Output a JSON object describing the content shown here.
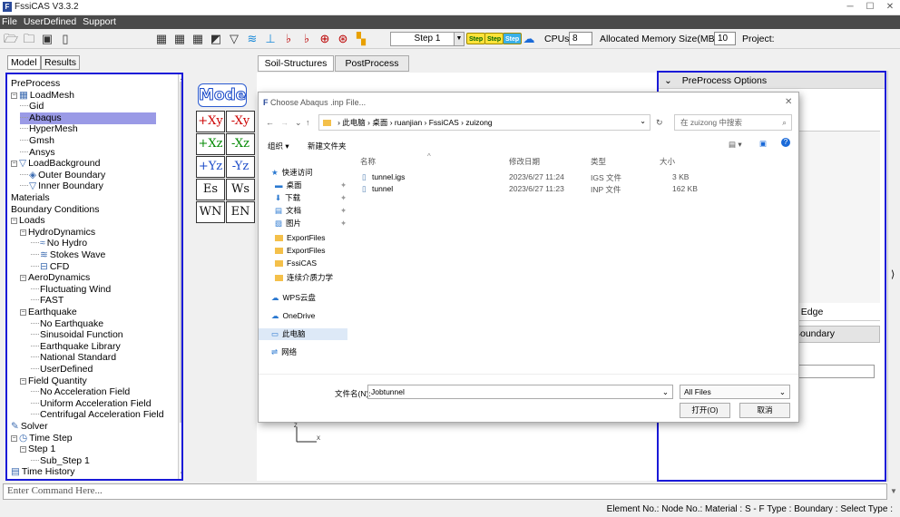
{
  "app": {
    "title": "FssiCAS V3.3.2"
  },
  "menu": [
    "File",
    "UserDefined",
    "Support"
  ],
  "toolbar": {
    "step_value": "Step 1",
    "step_buttons": [
      "Step",
      "Step",
      "Step"
    ],
    "cpus_label": "CPUs",
    "cpus_value": "8",
    "mem_label": "Allocated Memory Size(MB) :",
    "mem_value": "10",
    "project_label": "Project:"
  },
  "left_tabs": [
    "Model",
    "Results"
  ],
  "tree": [
    {
      "label": "PreProcess",
      "x": 0
    },
    {
      "label": "LoadMesh",
      "x": 0
    },
    {
      "label": "Gid",
      "x": 1
    },
    {
      "label": "Abaqus",
      "x": 1,
      "selected": true
    },
    {
      "label": "HyperMesh",
      "x": 1
    },
    {
      "label": "Gmsh",
      "x": 1
    },
    {
      "label": "Ansys",
      "x": 1
    },
    {
      "label": "LoadBackground",
      "x": 0
    },
    {
      "label": "Outer Boundary",
      "x": 1
    },
    {
      "label": "Inner Boundary",
      "x": 1
    },
    {
      "label": "Materials",
      "x": 0
    },
    {
      "label": "Boundary Conditions",
      "x": 0
    },
    {
      "label": "Loads",
      "x": 0
    },
    {
      "label": "HydroDynamics",
      "x": 1
    },
    {
      "label": "No Hydro",
      "x": 2
    },
    {
      "label": "Stokes Wave",
      "x": 2
    },
    {
      "label": "CFD",
      "x": 2
    },
    {
      "label": "AeroDynamics",
      "x": 1
    },
    {
      "label": "Fluctuating Wind",
      "x": 2
    },
    {
      "label": "FAST",
      "x": 2
    },
    {
      "label": "Earthquake",
      "x": 1
    },
    {
      "label": "No Earthquake",
      "x": 2
    },
    {
      "label": "Sinusoidal Function",
      "x": 2
    },
    {
      "label": "Earthquake Library",
      "x": 2
    },
    {
      "label": "National Standard",
      "x": 2
    },
    {
      "label": "UserDefined",
      "x": 2
    },
    {
      "label": "Field Quantity",
      "x": 1
    },
    {
      "label": "No Acceleration Field",
      "x": 2
    },
    {
      "label": "Uniform Acceleration Field",
      "x": 2
    },
    {
      "label": "Centrifugal Acceleration Field",
      "x": 2
    },
    {
      "label": "Solver",
      "x": 0
    },
    {
      "label": "Time Step",
      "x": 0
    },
    {
      "label": "Step 1",
      "x": 1
    },
    {
      "label": "Sub_Step 1",
      "x": 2
    },
    {
      "label": "Time History",
      "x": 0
    }
  ],
  "mode_button": "Mode",
  "view_buttons": [
    [
      "+Xy",
      "-Xy"
    ],
    [
      "+Xz",
      "-Xz"
    ],
    [
      "+Yz",
      "-Yz"
    ],
    [
      "Es",
      "Ws"
    ],
    [
      "WN",
      "EN"
    ]
  ],
  "center_tabs": [
    "Soil-Structures",
    "PostProcess"
  ],
  "right_panel": {
    "header": "PreProcess Options",
    "frag1": "h Edge",
    "frag2": "Boundary",
    "frag3": "a"
  },
  "dialog": {
    "title": "Choose Abaqus .inp File...",
    "path": [
      "此电脑",
      "桌面",
      "ruanjian",
      "FssiCAS",
      "zuizong"
    ],
    "search_placeholder": "在 zuizong 中搜索",
    "organize": "组织 ▾",
    "new_folder": "新建文件夹",
    "columns": [
      "名称",
      "修改日期",
      "类型",
      "大小"
    ],
    "files": [
      {
        "name": "tunnel.igs",
        "date": "2023/6/27 11:24",
        "type": "IGS 文件",
        "size": "3 KB"
      },
      {
        "name": "tunnel",
        "date": "2023/6/27 11:23",
        "type": "INP 文件",
        "size": "162 KB"
      }
    ],
    "sidebar": [
      "快速访问",
      "桌面",
      "下载",
      "文档",
      "图片",
      "ExportFiles",
      "ExportFiles",
      "FssiCAS",
      "连续介质力学",
      "WPS云盘",
      "OneDrive",
      "此电脑",
      "网络"
    ],
    "filename_label": "文件名(N):",
    "filename_value": "Jobtunnel",
    "filter": "All Files",
    "open_btn": "打开(O)",
    "cancel_btn": "取消"
  },
  "command_placeholder": "Enter Command Here...",
  "status": "Element No.:  Node No.:  Material :  S - F Type :  Boundary :  Select Type :"
}
